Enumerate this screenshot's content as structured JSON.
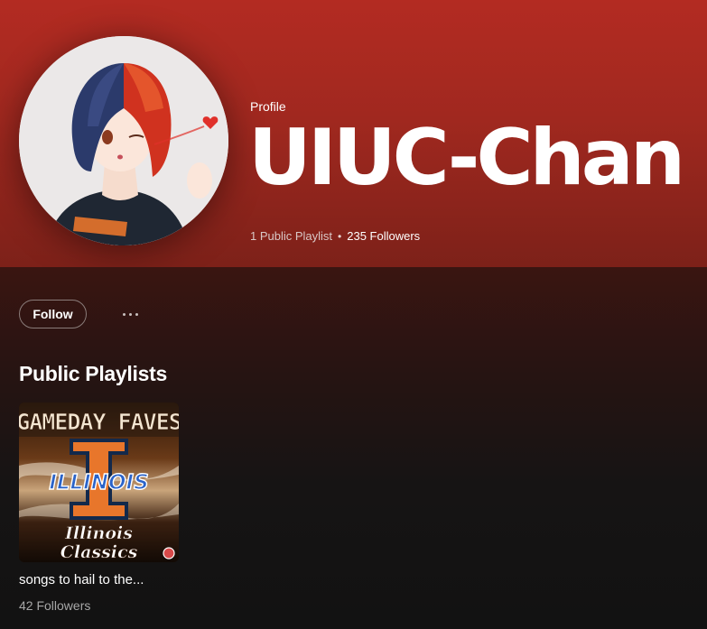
{
  "header": {
    "profile_type": "Profile",
    "name": "UIUC-Chan",
    "public_playlists": "1 Public Playlist",
    "separator": "•",
    "followers": "235 Followers"
  },
  "actions": {
    "follow_label": "Follow",
    "more_icon": "more-options-icon"
  },
  "section": {
    "title": "Public Playlists"
  },
  "playlists": [
    {
      "title": "songs to hail to the...",
      "followers": "42 Followers",
      "cover": {
        "top_text": "GAMEDAY FAVES",
        "center_text": "ILLINOIS",
        "bottom_line1": "Illinois",
        "bottom_line2": "Classics"
      }
    }
  ],
  "colors": {
    "header_gradient_top": "#b32b22",
    "header_gradient_bottom": "#7d2119",
    "background": "#121212",
    "illini_orange": "#e8762b",
    "illini_blue": "#13294b"
  }
}
